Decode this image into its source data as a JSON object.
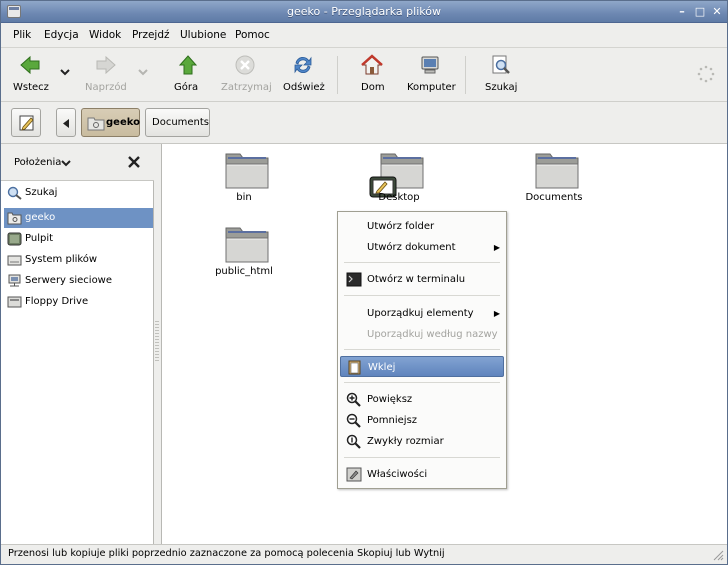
{
  "window": {
    "title": "geeko - Przeglądarka plików"
  },
  "titlebar_buttons": [
    "–",
    "□",
    "✕"
  ],
  "menubar": [
    "Plik",
    "Edycja",
    "Widok",
    "Przejdź",
    "Ulubione",
    "Pomoc"
  ],
  "toolbar": {
    "back": "Wstecz",
    "forward": "Naprzód",
    "up": "Góra",
    "stop": "Zatrzymaj",
    "reload": "Odśwież",
    "home": "Dom",
    "computer": "Komputer",
    "search": "Szukaj"
  },
  "locationbar": {
    "crumbs": [
      "geeko",
      "Documents"
    ]
  },
  "sidebar": {
    "header": "Położenia",
    "items": [
      {
        "label": "Szukaj",
        "icon": "search-icon"
      },
      {
        "label": "geeko",
        "icon": "home-folder-icon"
      },
      {
        "label": "Pulpit",
        "icon": "desktop-icon"
      },
      {
        "label": "System plików",
        "icon": "drive-icon"
      },
      {
        "label": "Serwery sieciowe",
        "icon": "network-icon"
      },
      {
        "label": "Floppy Drive",
        "icon": "floppy-icon"
      }
    ]
  },
  "files": [
    {
      "name": "bin"
    },
    {
      "name": "Desktop"
    },
    {
      "name": "Documents"
    },
    {
      "name": "public_html"
    }
  ],
  "context_menu": {
    "items": [
      "Utwórz folder",
      "Utwórz dokument",
      "Otwórz w terminalu",
      "Uporządkuj elementy",
      "Uporządkuj według nazwy",
      "Wklej",
      "Powiększ",
      "Pomniejsz",
      "Zwykły rozmiar",
      "Właściwości"
    ]
  },
  "statusbar": {
    "text": "Przenosi lub kopiuje pliki poprzednio zaznaczone za pomocą polecenia Skopiuj lub Wytnij"
  },
  "colors": {
    "titlebar": "#6d88b2",
    "selection": "#6e92c4",
    "window_bg": "#eeeeec"
  }
}
